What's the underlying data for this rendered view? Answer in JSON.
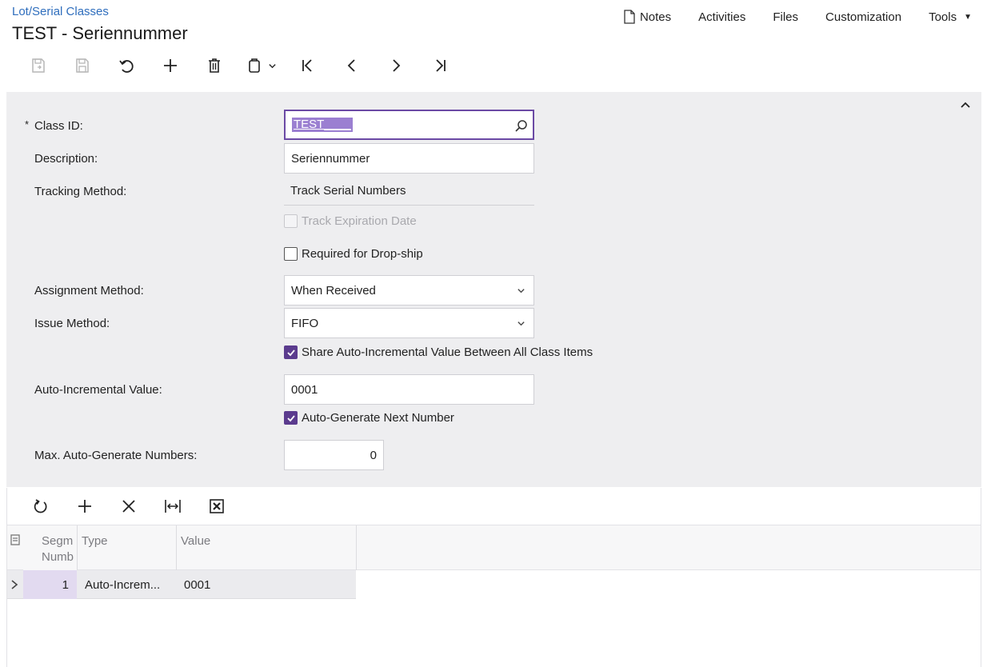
{
  "header": {
    "breadcrumb": "Lot/Serial Classes",
    "title": "TEST - Seriennummer"
  },
  "top_menu": {
    "notes": "Notes",
    "activities": "Activities",
    "files": "Files",
    "customization": "Customization",
    "tools": "Tools"
  },
  "toolbar_icons": [
    "save-close-icon",
    "save-icon",
    "undo-icon",
    "add-icon",
    "delete-icon",
    "copy-paste-icon",
    "first-record-icon",
    "previous-record-icon",
    "next-record-icon",
    "last-record-icon"
  ],
  "form": {
    "required_marker": "*",
    "class_id": {
      "label": "Class ID:",
      "value": "TEST____"
    },
    "description": {
      "label": "Description:",
      "value": "Seriennummer"
    },
    "tracking_method": {
      "label": "Tracking Method:",
      "value": "Track Serial Numbers"
    },
    "track_expiration": {
      "label": "Track Expiration Date",
      "checked": false,
      "disabled": true
    },
    "required_dropship": {
      "label": "Required for Drop-ship",
      "checked": false
    },
    "assignment_method": {
      "label": "Assignment Method:",
      "value": "When Received"
    },
    "issue_method": {
      "label": "Issue Method:",
      "value": "FIFO"
    },
    "share_autoinc": {
      "label": "Share Auto-Incremental Value Between All Class Items",
      "checked": true
    },
    "auto_incremental_value": {
      "label": "Auto-Incremental Value:",
      "value": "0001"
    },
    "auto_generate_next": {
      "label": "Auto-Generate Next Number",
      "checked": true
    },
    "max_auto_generate": {
      "label": "Max. Auto-Generate Numbers:",
      "value": "0"
    }
  },
  "grid": {
    "toolbar_icons": [
      "refresh-icon",
      "add-row-icon",
      "delete-row-icon",
      "fit-columns-icon",
      "export-excel-icon"
    ],
    "columns": {
      "segment_line1": "Segm",
      "segment_line2": "Numb",
      "type": "Type",
      "value": "Value"
    },
    "rows": [
      {
        "segment_number": "1",
        "type": "Auto-Increm...",
        "value": "0001"
      }
    ]
  },
  "colors": {
    "accent": "#5b3b8e",
    "selection": "#9b7fd1",
    "link": "#2f6ebd",
    "panel_bg": "#eeeef0"
  }
}
